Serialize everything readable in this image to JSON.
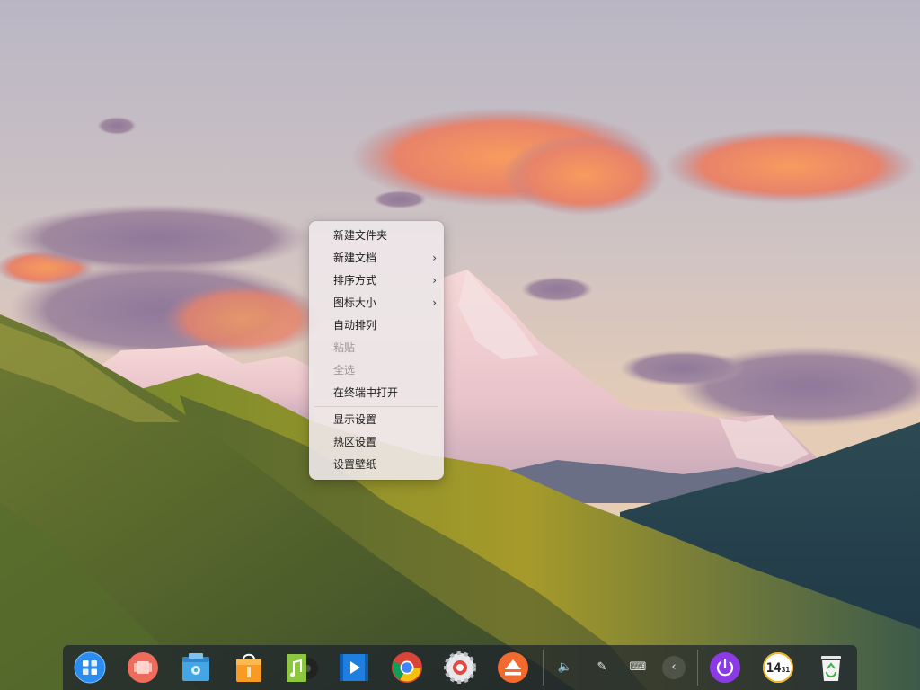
{
  "context_menu": {
    "items": [
      {
        "label": "新建文件夹",
        "has_submenu": false,
        "disabled": false
      },
      {
        "label": "新建文档",
        "has_submenu": true,
        "disabled": false
      },
      {
        "label": "排序方式",
        "has_submenu": true,
        "disabled": false
      },
      {
        "label": "图标大小",
        "has_submenu": true,
        "disabled": false
      },
      {
        "label": "自动排列",
        "has_submenu": false,
        "disabled": false
      },
      {
        "label": "粘贴",
        "has_submenu": false,
        "disabled": true
      },
      {
        "label": "全选",
        "has_submenu": false,
        "disabled": true
      },
      {
        "label": "在终端中打开",
        "has_submenu": false,
        "disabled": false
      },
      {
        "label": "显示设置",
        "has_submenu": false,
        "disabled": false
      },
      {
        "label": "热区设置",
        "has_submenu": false,
        "disabled": false
      },
      {
        "label": "设置壁纸",
        "has_submenu": false,
        "disabled": false
      }
    ],
    "submenu_arrow": "›"
  },
  "dock": {
    "apps": [
      {
        "name": "launcher-icon"
      },
      {
        "name": "multitasking-view-icon"
      },
      {
        "name": "file-manager-icon"
      },
      {
        "name": "app-store-icon"
      },
      {
        "name": "music-player-icon"
      },
      {
        "name": "movie-player-icon"
      },
      {
        "name": "chrome-browser-icon"
      },
      {
        "name": "control-center-icon"
      },
      {
        "name": "eject-disk-icon"
      }
    ],
    "tray": [
      {
        "name": "volume-icon",
        "glyph": "🔈"
      },
      {
        "name": "pen-icon",
        "glyph": "✎"
      },
      {
        "name": "keyboard-icon",
        "glyph": "⌨"
      },
      {
        "name": "tray-expand-icon",
        "glyph": "‹"
      }
    ],
    "clock": {
      "hours": "14",
      "minutes": "31"
    }
  },
  "colors": {
    "launcher": "#2d8cf0",
    "multitask": "#ef6b5c",
    "power": "#8b3be5",
    "chrome_red": "#db4437",
    "chrome_yellow": "#f4c20d",
    "chrome_green": "#0f9d58",
    "chrome_blue": "#4285f4"
  }
}
